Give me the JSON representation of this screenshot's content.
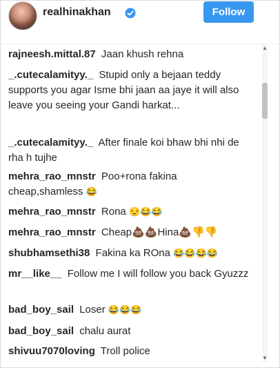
{
  "profile": {
    "username": "realhinakhan",
    "follow_label": "Follow",
    "accent_color": "#3897f0",
    "verified_icon": "verified-badge-icon"
  },
  "comments": [
    {
      "author": "rajneesh.mittal.87",
      "text": "Jaan khush rehna",
      "emoji": ""
    },
    {
      "author": "_.cutecalamityy._",
      "text": "Stupid only a bejaan teddy supports you agar Isme bhi jaan aa jaye it will also leave you seeing your Gandi harkat...",
      "emoji": ""
    },
    {
      "author": "_.cutecalamityy._",
      "text": "After finale koi bhaw bhi nhi de rha h tujhe",
      "emoji": ""
    },
    {
      "author": "mehra_rao_mnstr",
      "text": "Poo+rona fakina cheap,shamless",
      "emoji": "😂"
    },
    {
      "author": "mehra_rao_mnstr",
      "text": "Rona",
      "emoji": "😒😂😂"
    },
    {
      "author": "mehra_rao_mnstr",
      "text": "Cheap💩💩Hina💩👎👎",
      "emoji": ""
    },
    {
      "author": "shubhamsethi38",
      "text": "Fakina ka ROna",
      "emoji": "😂😂😂😂"
    },
    {
      "author": "mr__like__",
      "text": "Follow me I will follow you back Gyuzzz",
      "emoji": ""
    },
    {
      "author": "bad_boy_sail",
      "text": "Loser",
      "emoji": "😂😂😂"
    },
    {
      "author": "bad_boy_sail",
      "text": "chalu aurat",
      "emoji": ""
    },
    {
      "author": "shivuu7070loving",
      "text": "Troll police",
      "emoji": ""
    }
  ]
}
